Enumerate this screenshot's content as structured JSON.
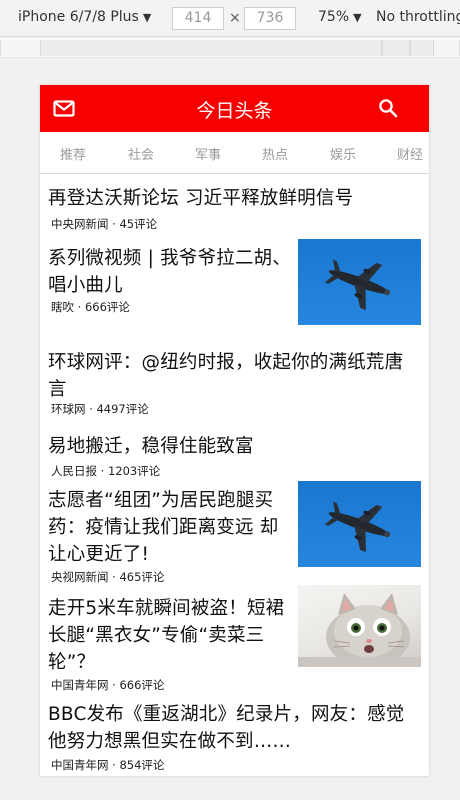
{
  "devtools": {
    "device": "iPhone 6/7/8 Plus",
    "width": "414",
    "height": "736",
    "times": "×",
    "zoom": "75%",
    "throttle": "No throttling",
    "caret": "▼"
  },
  "app": {
    "title": "今日头条",
    "mail_icon": "mail-icon",
    "search_icon": "search-icon",
    "brand_color": "#f70000"
  },
  "tabs": [
    "推荐",
    "社会",
    "军事",
    "热点",
    "娱乐",
    "财经"
  ],
  "news": [
    {
      "title_lines": [
        "再登达沃斯论坛 习近平释放鲜明信号"
      ],
      "meta": "中央网新闻 · 45评论",
      "thumb": ""
    },
    {
      "title_lines": [
        "系列微视频 | 我爷爷拉二胡、",
        "唱小曲儿"
      ],
      "meta": "瞎吹 · 666评论",
      "thumb": "airplane"
    },
    {
      "title_lines": [
        "环球网评：@纽约时报，收起你的满纸荒唐",
        "言"
      ],
      "meta": "环球网 · 4497评论",
      "thumb": ""
    },
    {
      "title_lines": [
        "易地搬迁，稳得住能致富"
      ],
      "meta": "人民日报 · 1203评论",
      "thumb": ""
    },
    {
      "title_lines": [
        "志愿者“组团”为居民跑腿买",
        "药：疫情让我们距离变远 却",
        "让心更近了!"
      ],
      "meta": "央视网新闻 · 465评论",
      "thumb": "airplane"
    },
    {
      "title_lines": [
        "走开5米车就瞬间被盗！短裙",
        "长腿“黑衣女”专偷“卖菜三",
        "轮”？"
      ],
      "meta": "中国青年网 · 666评论",
      "thumb": "cat"
    },
    {
      "title_lines": [
        "BBC发布《重返湖北》纪录片，网友：感觉",
        "他努力想黑但实在做不到……"
      ],
      "meta": "中国青年网 · 854评论",
      "thumb": ""
    }
  ]
}
